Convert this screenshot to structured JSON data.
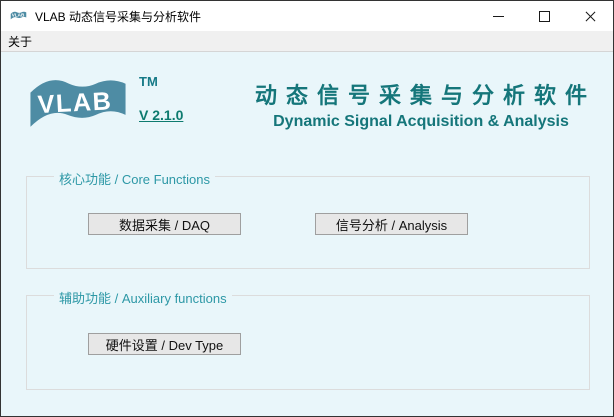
{
  "window": {
    "title": "VLAB 动态信号采集与分析软件"
  },
  "icons": {
    "app_icon": "vlab-wave-logo",
    "minimize_icon": "horizontal-line",
    "maximize_icon": "square-outline",
    "close_icon": "x-cross"
  },
  "menu": {
    "items": [
      {
        "label": "关于"
      }
    ]
  },
  "brand": {
    "logo_text": "VLAB",
    "trademark": "TM",
    "version": "V 2.1.0",
    "title_zh": "动态信号采集与分析软件",
    "title_en": "Dynamic Signal Acquisition & Analysis"
  },
  "sections": [
    {
      "label": "核心功能 / Core Functions",
      "buttons": [
        {
          "label": "数据采集 / DAQ"
        },
        {
          "label": "信号分析 / Analysis"
        }
      ]
    },
    {
      "label": "辅助功能 / Auxiliary functions",
      "buttons": [
        {
          "label": "硬件设置 / Dev Type"
        }
      ]
    }
  ],
  "colors": {
    "client_background": "#e9f6fa",
    "logo_band": "#4e8ca4",
    "heading_teal": "#15767a",
    "group_label_teal": "#2d98a6",
    "version_teal": "#0e7b6f",
    "button_face": "#e7e7e7",
    "button_border": "#9f9f9f",
    "window_border": "#333333"
  }
}
